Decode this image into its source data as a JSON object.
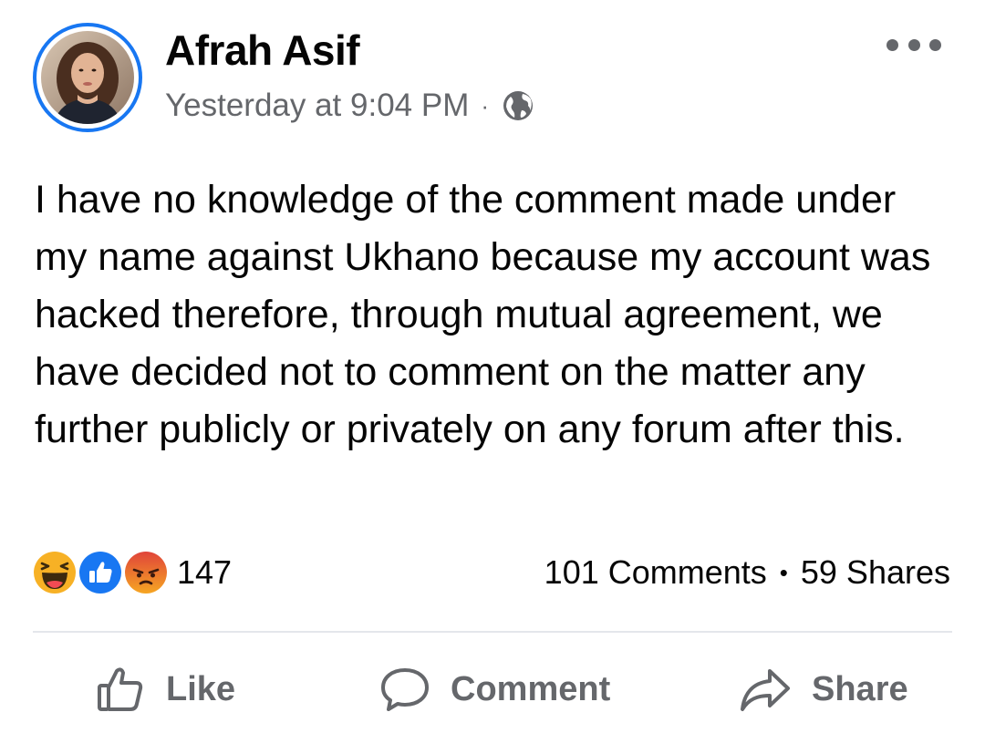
{
  "post": {
    "author": "Afrah Asif",
    "timestamp": "Yesterday at 9:04 PM",
    "meta_separator": "·",
    "privacy_icon": "globe-icon",
    "text": "I have no knowledge of the comment made under my name against Ukhano because my account was hacked therefore, through mutual agreement, we have decided not to comment on the matter any further publicly or privately on any forum after this."
  },
  "reactions": {
    "types": [
      "haha-reaction-icon",
      "like-reaction-icon",
      "angry-reaction-icon"
    ],
    "count": "147"
  },
  "stats": {
    "comments": "101 Comments",
    "separator": "•",
    "shares": "59 Shares"
  },
  "actions": {
    "like_label": "Like",
    "comment_label": "Comment",
    "share_label": "Share"
  },
  "colors": {
    "avatar_ring": "#1877f2",
    "secondary_text": "#65676b",
    "primary_text": "#050505",
    "divider": "#e4e6eb",
    "like_blue": "#1877f2",
    "haha_yellow": "#f7b125",
    "angry_orange": "#e9710f"
  }
}
